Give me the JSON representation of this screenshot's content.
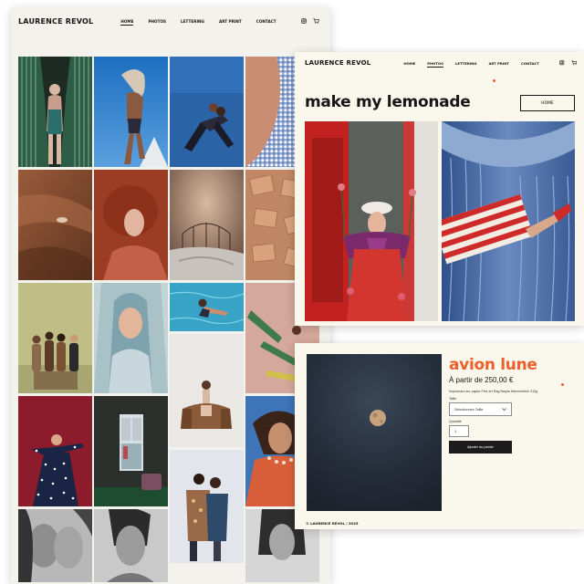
{
  "home": {
    "logo": "LAURENCE REVOL",
    "nav": [
      "HOME",
      "PHOTOS",
      "LETTERING",
      "ART PRINT",
      "CONTACT"
    ],
    "active_nav": "HOME",
    "icons": [
      "instagram-icon",
      "cart-icon"
    ]
  },
  "lemonade": {
    "logo": "LAURENCE REVOL",
    "nav": [
      "HOME",
      "PHOTOS",
      "LETTERING",
      "ART PRINT",
      "CONTACT"
    ],
    "active_nav": "PHOTOS",
    "title": "make my lemonade",
    "home_button": "HOME"
  },
  "product": {
    "title": "avion lune",
    "price": "À partir de 250,00 €",
    "description": "Impression sur papier Fine art Rag Baryta Hahnemühle 315g",
    "size_label": "Taille",
    "size_value": "Sélectionnez Taille",
    "quantity_label": "Quantité",
    "quantity_value": "1",
    "add_to_cart": "Ajouter au panier",
    "footer": "© LAURENCE REVOL / 2025"
  },
  "colors": {
    "accent": "#ec5f2c",
    "ink": "#161616",
    "cream": "#faf7ec",
    "panel": "#f4f2ec"
  }
}
